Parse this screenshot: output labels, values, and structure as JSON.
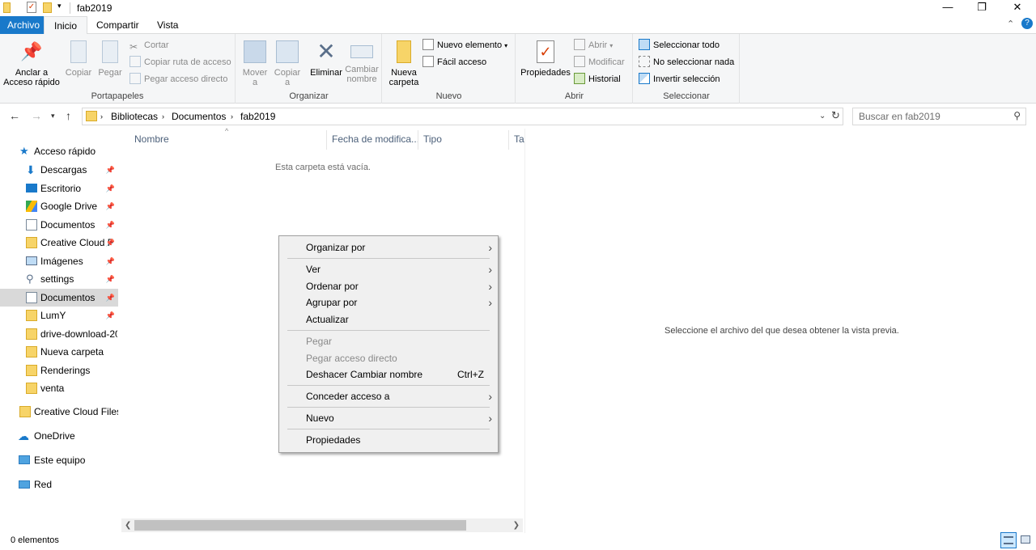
{
  "window": {
    "title": "fab2019",
    "minimize": "—",
    "restore": "❐",
    "close": "✕"
  },
  "ribbon_tabs": [
    "Archivo",
    "Inicio",
    "Compartir",
    "Vista"
  ],
  "ribbon": {
    "portapapeles": {
      "label": "Portapapeles",
      "anclar": "Anclar a\nAcceso rápido",
      "copiar": "Copiar",
      "pegar": "Pegar",
      "cortar": "Cortar",
      "copiar_ruta": "Copiar ruta de acceso",
      "pegar_acceso": "Pegar acceso directo"
    },
    "organizar": {
      "label": "Organizar",
      "mover": "Mover\na",
      "copiar_a": "Copiar\na",
      "eliminar": "Eliminar",
      "cambiar": "Cambiar\nnombre"
    },
    "nuevo": {
      "label": "Nuevo",
      "nueva_carpeta": "Nueva\ncarpeta",
      "nuevo_elemento": "Nuevo elemento",
      "facil_acceso": "Fácil acceso"
    },
    "abrir": {
      "label": "Abrir",
      "propiedades": "Propiedades",
      "abrir": "Abrir",
      "modificar": "Modificar",
      "historial": "Historial"
    },
    "seleccionar": {
      "label": "Seleccionar",
      "todo": "Seleccionar todo",
      "nada": "No seleccionar nada",
      "invertir": "Invertir selección"
    }
  },
  "address": {
    "crumbs": [
      "Bibliotecas",
      "Documentos",
      "fab2019"
    ],
    "search_placeholder": "Buscar en fab2019"
  },
  "nav_pane": {
    "quick_access": "Acceso rápido",
    "quick_items": [
      "Descargas",
      "Escritorio",
      "Google Drive",
      "Documentos",
      "Creative Cloud F",
      "Imágenes",
      "settings",
      "Documentos",
      "LumY",
      "drive-download-20",
      "Nueva carpeta",
      "Renderings",
      "venta"
    ],
    "creative_cloud": "Creative Cloud Files",
    "onedrive": "OneDrive",
    "este_equipo": "Este equipo",
    "red": "Red"
  },
  "columns": [
    "Nombre",
    "Fecha de modifica...",
    "Tipo",
    "Ta"
  ],
  "empty_text": "Esta carpeta está vacía.",
  "preview_text": "Seleccione el archivo del que desea obtener la vista previa.",
  "status": "0 elementos",
  "context_menu": {
    "organizar_por": "Organizar por",
    "ver": "Ver",
    "ordenar_por": "Ordenar por",
    "agrupar_por": "Agrupar por",
    "actualizar": "Actualizar",
    "pegar": "Pegar",
    "pegar_acceso": "Pegar acceso directo",
    "deshacer": "Deshacer Cambiar nombre",
    "deshacer_accel": "Ctrl+Z",
    "conceder": "Conceder acceso a",
    "nuevo": "Nuevo",
    "propiedades": "Propiedades"
  }
}
